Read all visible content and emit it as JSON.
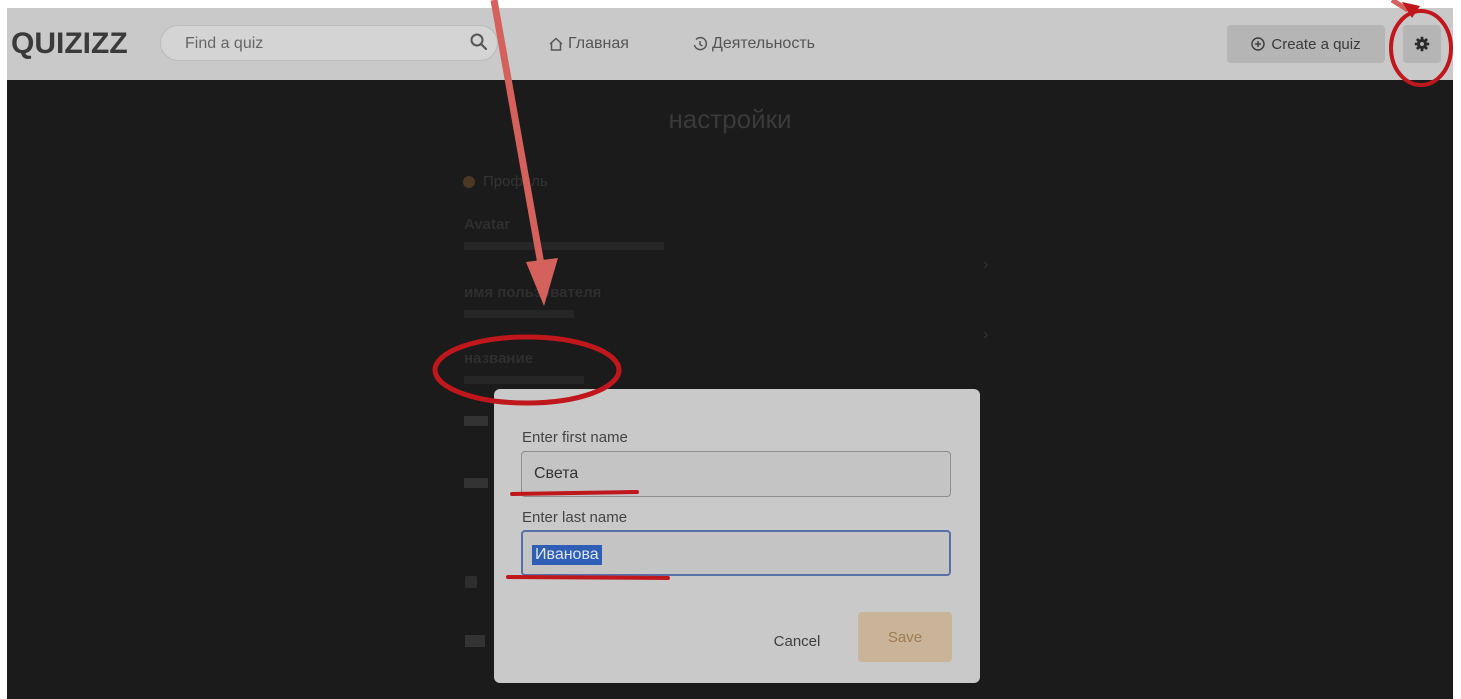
{
  "header": {
    "logo": "QUIZIZZ",
    "search_placeholder": "Find a quiz",
    "nav_home": "Главная",
    "nav_activity": "Деятельность",
    "create_quiz": "Create a quiz"
  },
  "settings": {
    "title": "настройки",
    "section": "Профиль",
    "avatar_label": "Avatar",
    "username_label": "имя пользователя",
    "name_label": "название"
  },
  "modal": {
    "first_name_label": "Enter first name",
    "first_name_value": "Света",
    "last_name_label": "Enter last name",
    "last_name_value": "Иванова",
    "cancel_label": "Cancel",
    "save_label": "Save"
  },
  "colors": {
    "annotation": "#c0171c",
    "arrow": "#d4615b",
    "save_text": "#9f7c52",
    "selection": "#2f5eb6"
  },
  "icons": {
    "search": "search-icon",
    "home": "home-icon",
    "activity": "history-icon",
    "create": "plus-circle-icon",
    "settings": "gear-icon"
  }
}
